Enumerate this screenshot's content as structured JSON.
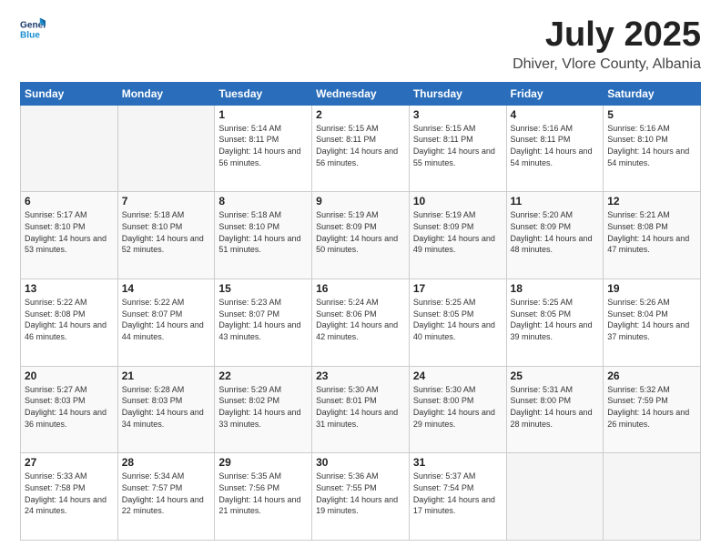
{
  "header": {
    "logo_line1": "General",
    "logo_line2": "Blue",
    "month": "July 2025",
    "location": "Dhiver, Vlore County, Albania"
  },
  "weekdays": [
    "Sunday",
    "Monday",
    "Tuesday",
    "Wednesday",
    "Thursday",
    "Friday",
    "Saturday"
  ],
  "weeks": [
    [
      {
        "day": "",
        "empty": true
      },
      {
        "day": "",
        "empty": true
      },
      {
        "day": "1",
        "sunrise": "5:14 AM",
        "sunset": "8:11 PM",
        "daylight": "14 hours and 56 minutes."
      },
      {
        "day": "2",
        "sunrise": "5:15 AM",
        "sunset": "8:11 PM",
        "daylight": "14 hours and 56 minutes."
      },
      {
        "day": "3",
        "sunrise": "5:15 AM",
        "sunset": "8:11 PM",
        "daylight": "14 hours and 55 minutes."
      },
      {
        "day": "4",
        "sunrise": "5:16 AM",
        "sunset": "8:11 PM",
        "daylight": "14 hours and 54 minutes."
      },
      {
        "day": "5",
        "sunrise": "5:16 AM",
        "sunset": "8:10 PM",
        "daylight": "14 hours and 54 minutes."
      }
    ],
    [
      {
        "day": "6",
        "sunrise": "5:17 AM",
        "sunset": "8:10 PM",
        "daylight": "14 hours and 53 minutes."
      },
      {
        "day": "7",
        "sunrise": "5:18 AM",
        "sunset": "8:10 PM",
        "daylight": "14 hours and 52 minutes."
      },
      {
        "day": "8",
        "sunrise": "5:18 AM",
        "sunset": "8:10 PM",
        "daylight": "14 hours and 51 minutes."
      },
      {
        "day": "9",
        "sunrise": "5:19 AM",
        "sunset": "8:09 PM",
        "daylight": "14 hours and 50 minutes."
      },
      {
        "day": "10",
        "sunrise": "5:19 AM",
        "sunset": "8:09 PM",
        "daylight": "14 hours and 49 minutes."
      },
      {
        "day": "11",
        "sunrise": "5:20 AM",
        "sunset": "8:09 PM",
        "daylight": "14 hours and 48 minutes."
      },
      {
        "day": "12",
        "sunrise": "5:21 AM",
        "sunset": "8:08 PM",
        "daylight": "14 hours and 47 minutes."
      }
    ],
    [
      {
        "day": "13",
        "sunrise": "5:22 AM",
        "sunset": "8:08 PM",
        "daylight": "14 hours and 46 minutes."
      },
      {
        "day": "14",
        "sunrise": "5:22 AM",
        "sunset": "8:07 PM",
        "daylight": "14 hours and 44 minutes."
      },
      {
        "day": "15",
        "sunrise": "5:23 AM",
        "sunset": "8:07 PM",
        "daylight": "14 hours and 43 minutes."
      },
      {
        "day": "16",
        "sunrise": "5:24 AM",
        "sunset": "8:06 PM",
        "daylight": "14 hours and 42 minutes."
      },
      {
        "day": "17",
        "sunrise": "5:25 AM",
        "sunset": "8:05 PM",
        "daylight": "14 hours and 40 minutes."
      },
      {
        "day": "18",
        "sunrise": "5:25 AM",
        "sunset": "8:05 PM",
        "daylight": "14 hours and 39 minutes."
      },
      {
        "day": "19",
        "sunrise": "5:26 AM",
        "sunset": "8:04 PM",
        "daylight": "14 hours and 37 minutes."
      }
    ],
    [
      {
        "day": "20",
        "sunrise": "5:27 AM",
        "sunset": "8:03 PM",
        "daylight": "14 hours and 36 minutes."
      },
      {
        "day": "21",
        "sunrise": "5:28 AM",
        "sunset": "8:03 PM",
        "daylight": "14 hours and 34 minutes."
      },
      {
        "day": "22",
        "sunrise": "5:29 AM",
        "sunset": "8:02 PM",
        "daylight": "14 hours and 33 minutes."
      },
      {
        "day": "23",
        "sunrise": "5:30 AM",
        "sunset": "8:01 PM",
        "daylight": "14 hours and 31 minutes."
      },
      {
        "day": "24",
        "sunrise": "5:30 AM",
        "sunset": "8:00 PM",
        "daylight": "14 hours and 29 minutes."
      },
      {
        "day": "25",
        "sunrise": "5:31 AM",
        "sunset": "8:00 PM",
        "daylight": "14 hours and 28 minutes."
      },
      {
        "day": "26",
        "sunrise": "5:32 AM",
        "sunset": "7:59 PM",
        "daylight": "14 hours and 26 minutes."
      }
    ],
    [
      {
        "day": "27",
        "sunrise": "5:33 AM",
        "sunset": "7:58 PM",
        "daylight": "14 hours and 24 minutes."
      },
      {
        "day": "28",
        "sunrise": "5:34 AM",
        "sunset": "7:57 PM",
        "daylight": "14 hours and 22 minutes."
      },
      {
        "day": "29",
        "sunrise": "5:35 AM",
        "sunset": "7:56 PM",
        "daylight": "14 hours and 21 minutes."
      },
      {
        "day": "30",
        "sunrise": "5:36 AM",
        "sunset": "7:55 PM",
        "daylight": "14 hours and 19 minutes."
      },
      {
        "day": "31",
        "sunrise": "5:37 AM",
        "sunset": "7:54 PM",
        "daylight": "14 hours and 17 minutes."
      },
      {
        "day": "",
        "empty": true
      },
      {
        "day": "",
        "empty": true
      }
    ]
  ],
  "labels": {
    "sunrise": "Sunrise:",
    "sunset": "Sunset:",
    "daylight": "Daylight:"
  }
}
